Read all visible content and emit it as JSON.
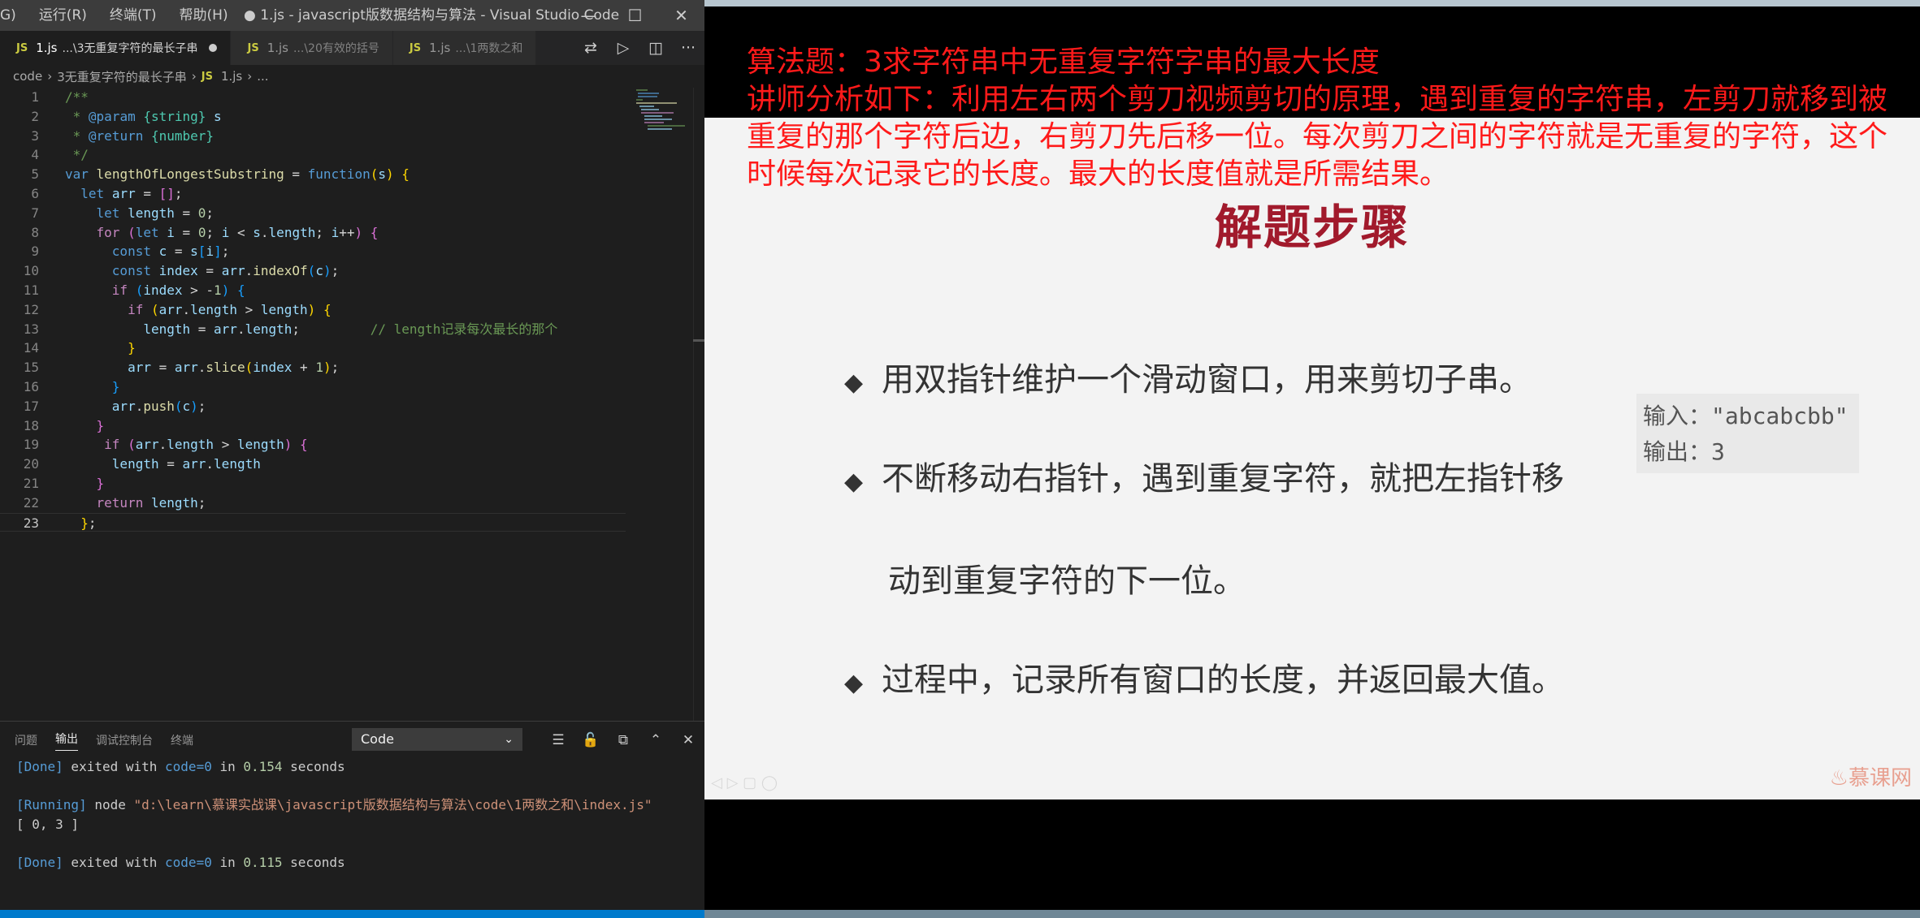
{
  "window": {
    "menu": [
      "G)",
      "运行(R)",
      "终端(T)",
      "帮助(H)"
    ],
    "title": "● 1.js - javascript版数据结构与算法 - Visual Studio Code",
    "controls": {
      "minimize": "—",
      "maximize": "☐",
      "close": "✕"
    }
  },
  "tabs": [
    {
      "badge": "JS",
      "name": "1.js",
      "path": "...\\3无重复字符的最长子串",
      "dirty": true
    },
    {
      "badge": "JS",
      "name": "1.js",
      "path": "...\\20有效的括号"
    },
    {
      "badge": "JS",
      "name": "1.js",
      "path": "...\\1两数之和"
    }
  ],
  "breadcrumb": {
    "root": "code",
    "folder": "3无重复字符的最长子串",
    "badge": "JS",
    "file": "1.js",
    "tail": "..."
  },
  "editor": {
    "line_numbers": [
      "1",
      "2",
      "3",
      "4",
      "5",
      "6",
      "7",
      "8",
      "9",
      "10",
      "11",
      "12",
      "13",
      "14",
      "15",
      "16",
      "17",
      "18",
      "19",
      "20",
      "21",
      "22",
      "23"
    ],
    "comment_inline": "// length记录每次最长的那个"
  },
  "panel": {
    "tabs": [
      "问题",
      "输出",
      "调试控制台",
      "终端"
    ],
    "active_tab": "输出",
    "channel": "Code",
    "output": {
      "done1": "[Done]",
      "done1_text": " exited with ",
      "done1_code": "code=0",
      "done1_in": " in ",
      "done1_time": "0.154",
      "done1_sec": " seconds",
      "running": "[Running]",
      "running_cmd": " node ",
      "running_path": "\"d:\\learn\\慕课实战课\\javascript版数据结构与算法\\code\\1两数之和\\index.js\"",
      "result": "[ 0, 3 ]",
      "done2": "[Done]",
      "done2_text": " exited with ",
      "done2_code": "code=0",
      "done2_in": " in ",
      "done2_time": "0.115",
      "done2_sec": " seconds"
    }
  },
  "slide": {
    "overlay": [
      "算法题：3求字符串中无重复字符字串的最大长度",
      "讲师分析如下：利用左右两个剪刀视频剪切的原理，遇到重复的字符串，左剪刀就移到被",
      "重复的那个字符后边，右剪刀先后移一位。每次剪刀之间的字符就是无重复的字符，这个",
      "时候每次记录它的长度。最大的长度值就是所需结果。"
    ],
    "title": "解题步骤",
    "bullets": [
      "用双指针维护一个滑动窗口，用来剪切子串。",
      "不断移动右指针，遇到重复字符，就把左指针移",
      "过程中，记录所有窗口的长度，并返回最大值。"
    ],
    "bullet2_cont": "动到重复字符的下一位。",
    "io": {
      "input": "输入：\"abcabcbb\"",
      "output": "输出：3"
    },
    "watermark": "慕课网"
  }
}
